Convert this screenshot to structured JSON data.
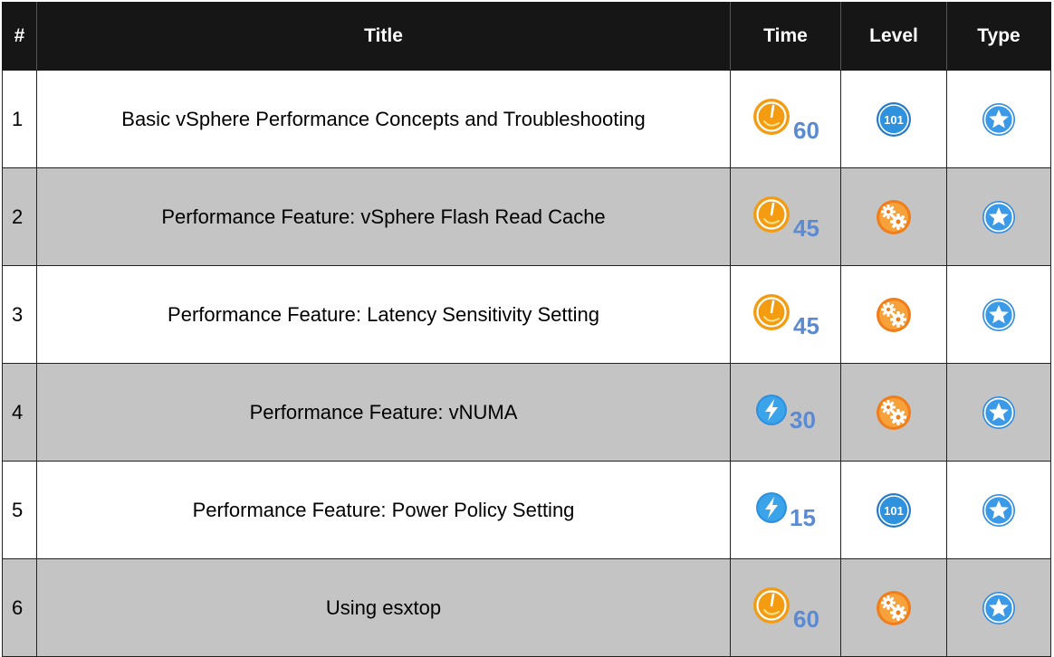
{
  "headers": {
    "num": "#",
    "title": "Title",
    "time": "Time",
    "level": "Level",
    "type": "Type"
  },
  "colors": {
    "time_number": "#5b8ad1",
    "stopwatch_orange": "#f39c12",
    "lightning_blue": "#2d8fdd",
    "level_blue": "#2379c8",
    "advanced_orange": "#f07d1a",
    "star_badge_blue": "#2b8ae0",
    "shaded_row": "#c4c4c4",
    "header_bg": "#161616"
  },
  "rows": [
    {
      "num": "1",
      "title": "Basic vSphere Performance Concepts and Troubleshooting",
      "time_icon": "stopwatch-icon",
      "time": "60",
      "level_icon": "level-101-icon",
      "level_text": "101",
      "type_icon": "star-badge-icon",
      "shaded": false
    },
    {
      "num": "2",
      "title": "Performance Feature: vSphere Flash Read Cache",
      "time_icon": "stopwatch-icon",
      "time": "45",
      "level_icon": "gears-icon",
      "type_icon": "star-badge-icon",
      "shaded": true
    },
    {
      "num": "3",
      "title": "Performance Feature: Latency Sensitivity Setting",
      "time_icon": "stopwatch-icon",
      "time": "45",
      "level_icon": "gears-icon",
      "type_icon": "star-badge-icon",
      "shaded": false
    },
    {
      "num": "4",
      "title": "Performance Feature: vNUMA",
      "time_icon": "lightning-icon",
      "time": "30",
      "level_icon": "gears-icon",
      "type_icon": "star-badge-icon",
      "shaded": true
    },
    {
      "num": "5",
      "title": "Performance Feature: Power Policy Setting",
      "time_icon": "lightning-icon",
      "time": "15",
      "level_icon": "level-101-icon",
      "level_text": "101",
      "type_icon": "star-badge-icon",
      "shaded": false
    },
    {
      "num": "6",
      "title": "Using esxtop",
      "time_icon": "stopwatch-icon",
      "time": "60",
      "level_icon": "gears-icon",
      "type_icon": "star-badge-icon",
      "shaded": true
    }
  ]
}
